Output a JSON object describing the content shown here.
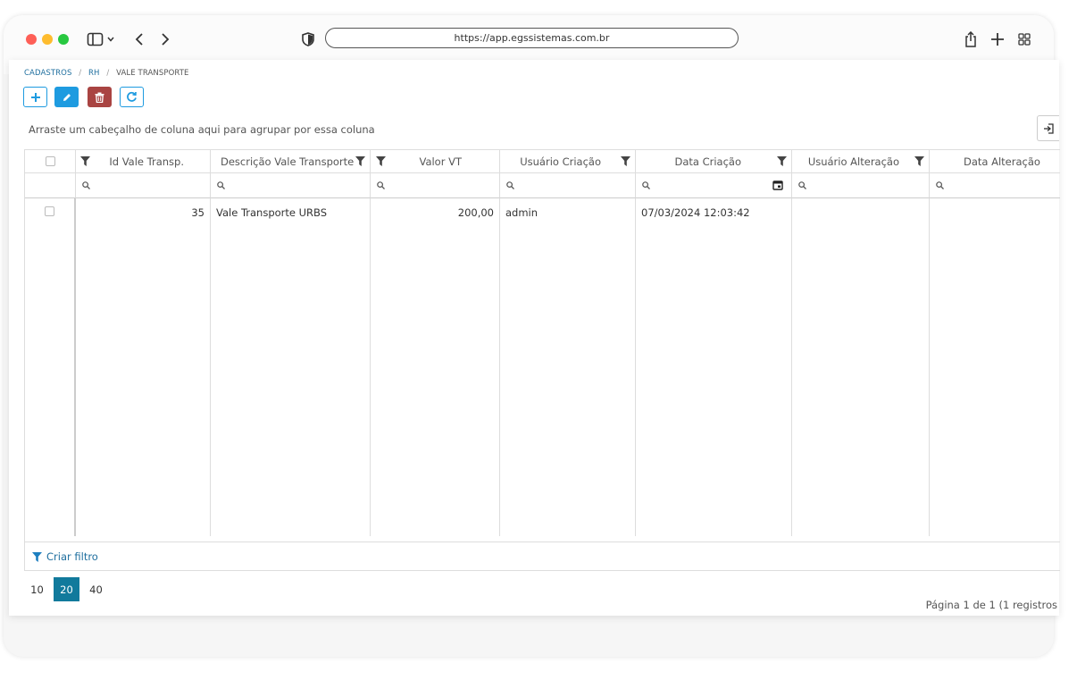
{
  "browser": {
    "url": "https://app.egssistemas.com.br"
  },
  "breadcrumb": {
    "items": [
      "CADASTROS",
      "RH",
      "VALE TRANSPORTE"
    ]
  },
  "toolbar": {
    "add_icon": "plus-icon",
    "edit_icon": "pencil-icon",
    "delete_icon": "trash-icon",
    "refresh_icon": "refresh-icon",
    "accent_color": "#1e9be0",
    "delete_color": "#a94442"
  },
  "group_panel": {
    "text": "Arraste um cabeçalho de coluna aqui para agrupar por essa coluna"
  },
  "grid": {
    "columns": [
      {
        "label": "Id Vale Transp."
      },
      {
        "label": "Descrição Vale Transporte"
      },
      {
        "label": "Valor VT"
      },
      {
        "label": "Usuário Criação"
      },
      {
        "label": "Data Criação"
      },
      {
        "label": "Usuário Alteração"
      },
      {
        "label": "Data Alteração"
      }
    ],
    "rows": [
      {
        "id": "35",
        "descricao": "Vale Transporte URBS",
        "valor": "200,00",
        "usuario_criacao": "admin",
        "data_criacao": "07/03/2024 12:03:42",
        "usuario_alteracao": "",
        "data_alteracao": ""
      }
    ]
  },
  "filter_footer": {
    "label": "Criar filtro"
  },
  "pager": {
    "sizes": [
      "10",
      "20",
      "40"
    ],
    "active_size": "20",
    "active_color": "#117a9c",
    "info": "Página 1 de 1 (1 registros"
  }
}
